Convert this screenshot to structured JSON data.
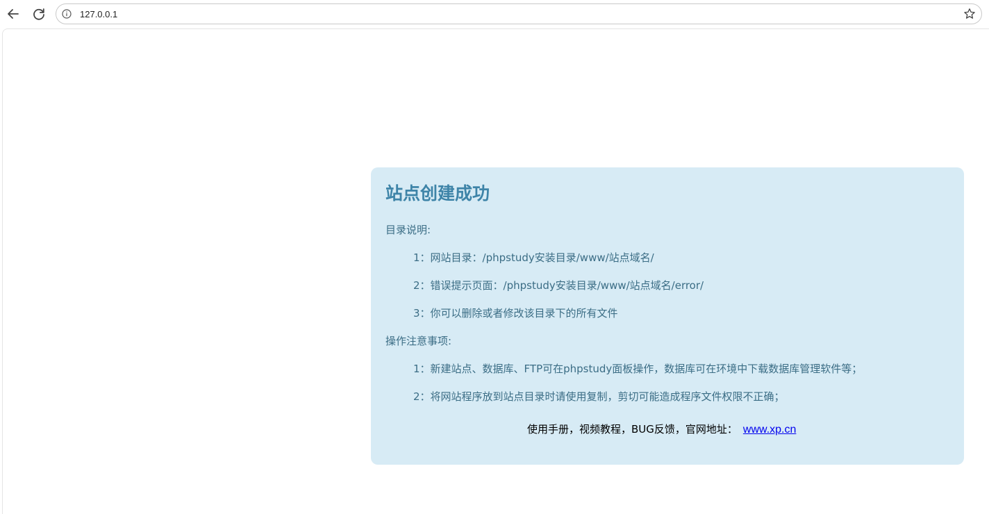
{
  "browser": {
    "url": "127.0.0.1"
  },
  "icons": {
    "back": "arrow-left-icon",
    "reload": "reload-icon",
    "info": "info-icon",
    "bookmark": "star-icon"
  },
  "colors": {
    "card_background": "#d7ebf5",
    "title": "#3e84a8",
    "body_text": "#3b6d85",
    "link": "#0000ee"
  },
  "card": {
    "title": "站点创建成功",
    "directory_heading": "目录说明:",
    "directory_items": [
      "1：网站目录：/phpstudy安装目录/www/站点域名/",
      "2：错误提示页面：/phpstudy安装目录/www/站点域名/error/",
      "3：你可以删除或者修改该目录下的所有文件"
    ],
    "notes_heading": "操作注意事项:",
    "notes_items": [
      "1：新建站点、数据库、FTP可在phpstudy面板操作，数据库可在环境中下载数据库管理软件等；",
      "2：将网站程序放到站点目录时请使用复制，剪切可能造成程序文件权限不正确；"
    ],
    "footer_text": "使用手册，视频教程，BUG反馈，官网地址：",
    "footer_link": "www.xp.cn"
  }
}
